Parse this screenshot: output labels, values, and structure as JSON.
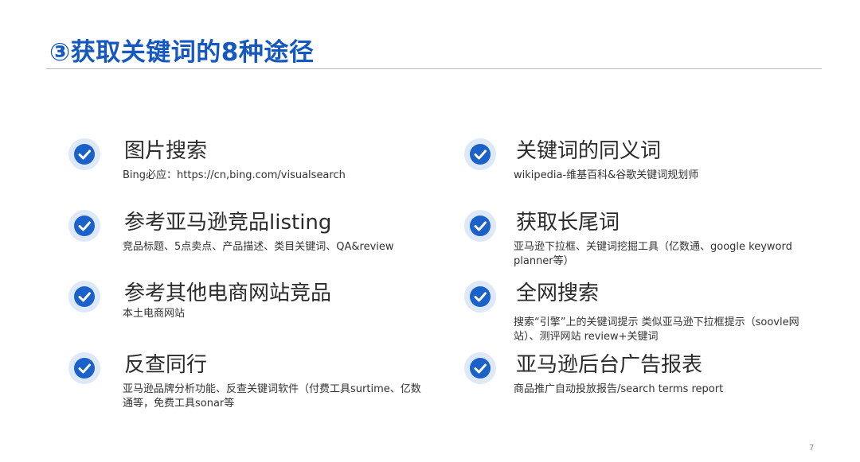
{
  "slide": {
    "title": "③获取关键词的8种途径",
    "page_number": "7",
    "colors": {
      "title": "#1558c0",
      "check_fill": "#1a62c9",
      "check_halo": "#dde8f8",
      "rule": "#b8b8b8"
    },
    "icon": "check-circle-icon",
    "left_items": [
      {
        "heading": "图片搜索",
        "desc": "Bing必应：https://cn,bing.com/visualsearch"
      },
      {
        "heading": "参考亚马逊竞品listing",
        "desc": "竞品标题、5点卖点、产品描述、类目关键词、QA&review"
      },
      {
        "heading": "参考其他电商网站竞品",
        "desc": "本土电商网站"
      },
      {
        "heading": "反查同行",
        "desc": "亚马逊品牌分析功能、反查关键词软件（付费工具surtime、亿数通等，免费工具sonar等"
      }
    ],
    "right_items": [
      {
        "heading": "关键词的同义词",
        "desc": "wikipedia-维基百科&谷歌关键词规划师"
      },
      {
        "heading": "获取长尾词",
        "desc": "亚马逊下拉框、关键词挖掘工具（亿数通、google keyword planner等）"
      },
      {
        "heading": "全网搜索",
        "desc": "搜索“引擎”上的关键词提示 类似亚马逊下拉框提示（soovle网站）、测评网站 review+关键词"
      },
      {
        "heading": "亚马逊后台广告报表",
        "desc": "商品推广自动投放报告/search terms report"
      }
    ]
  }
}
